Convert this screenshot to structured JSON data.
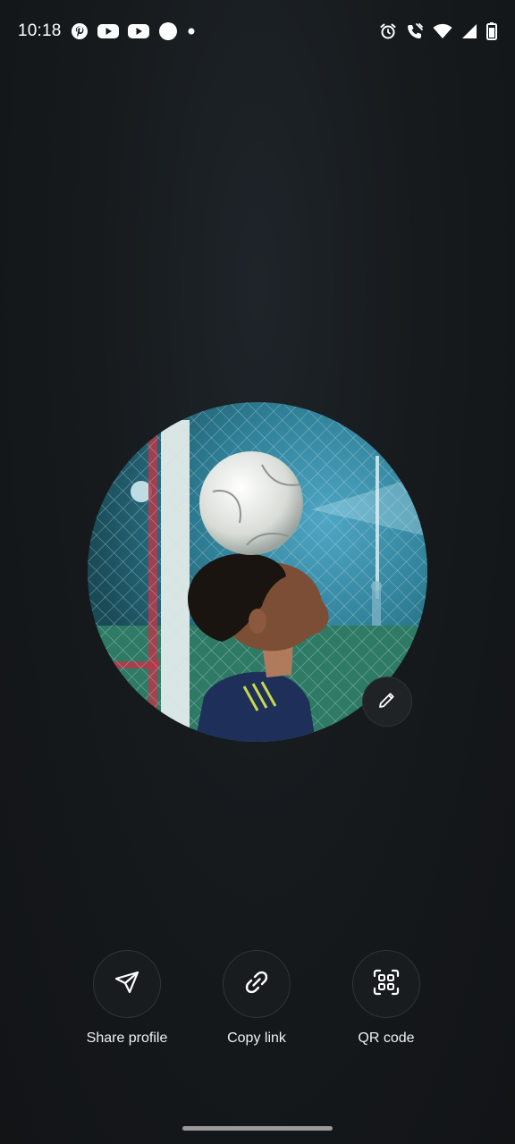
{
  "status_bar": {
    "time": "10:18",
    "left_icons": [
      "pinterest-icon",
      "youtube-icon",
      "youtube-icon",
      "circle-notification-icon",
      "dot-icon"
    ],
    "right_icons": [
      "alarm-icon",
      "wifi-call-icon",
      "wifi-icon",
      "signal-icon",
      "battery-icon"
    ]
  },
  "profile": {
    "avatar_description_icon": "profile-photo",
    "edit_icon": "pencil-icon"
  },
  "actions": [
    {
      "label": "Share profile",
      "icon": "send-icon"
    },
    {
      "label": "Copy link",
      "icon": "link-icon"
    },
    {
      "label": "QR code",
      "icon": "qr-scan-icon"
    }
  ],
  "colors": {
    "background": "#161a1d",
    "button_bg": "#191c1f",
    "text": "#f0f0f0"
  }
}
